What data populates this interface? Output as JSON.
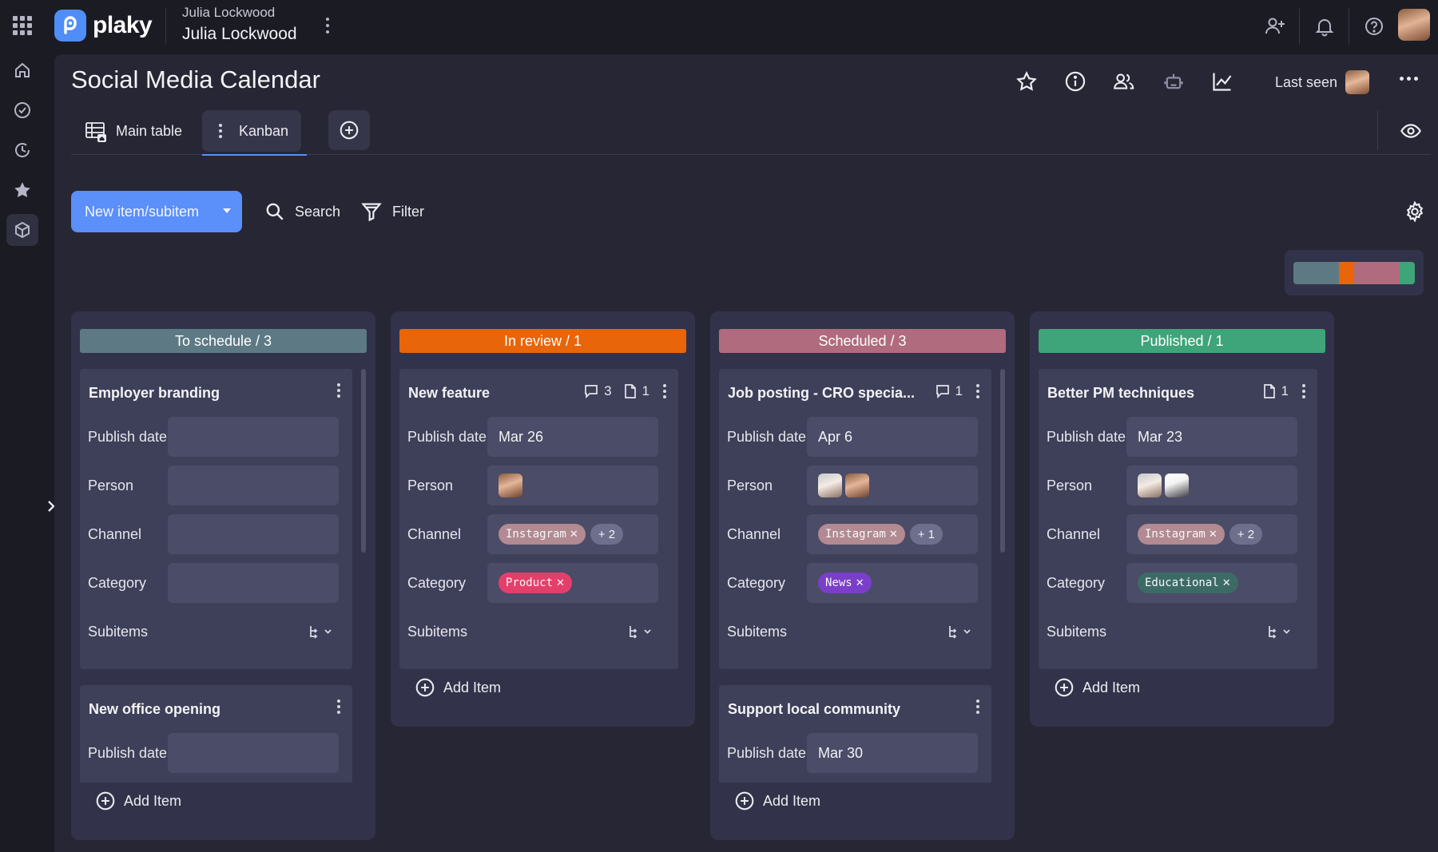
{
  "workspace": {
    "owner_small": "Julia Lockwood",
    "owner_name": "Julia Lockwood"
  },
  "brand": {
    "name": "plaky",
    "accent": "#5b8ff9"
  },
  "page": {
    "title": "Social Media Calendar",
    "last_seen_label": "Last seen"
  },
  "tabs": [
    {
      "label": "Main table"
    },
    {
      "label": "Kanban"
    }
  ],
  "toolbar": {
    "new_item_label": "New item/subitem",
    "search_label": "Search",
    "filter_label": "Filter"
  },
  "status_colors": {
    "to_schedule": "#5d7a84",
    "in_review": "#e8650a",
    "scheduled": "#b06b7e",
    "published": "#3ea47a"
  },
  "field_labels": {
    "publish_date": "Publish date",
    "person": "Person",
    "channel": "Channel",
    "category": "Category",
    "subitems": "Subitems"
  },
  "add_item_label": "Add Item",
  "columns": [
    {
      "header": "To schedule / 3",
      "cards": [
        {
          "title": "Employer branding",
          "publish_date": "",
          "channel": "",
          "category": ""
        },
        {
          "title": "New office opening",
          "publish_date": ""
        }
      ]
    },
    {
      "header": "In review / 1",
      "cards": [
        {
          "title": "New feature",
          "comments": "3",
          "files": "1",
          "publish_date": "Mar 26",
          "channel_tag": "Instagram",
          "channel_more": "+ 2",
          "category_tag": "Product"
        }
      ]
    },
    {
      "header": "Scheduled / 3",
      "cards": [
        {
          "title": "Job posting - CRO specia...",
          "comments": "1",
          "publish_date": "Apr 6",
          "channel_tag": "Instagram",
          "channel_more": "+ 1",
          "category_tag": "News"
        },
        {
          "title": "Support local community",
          "publish_date": "Mar 30"
        }
      ]
    },
    {
      "header": "Published / 1",
      "cards": [
        {
          "title": "Better PM techniques",
          "files": "1",
          "publish_date": "Mar 23",
          "channel_tag": "Instagram",
          "channel_more": "+ 2",
          "category_tag": "Educational"
        }
      ]
    }
  ]
}
